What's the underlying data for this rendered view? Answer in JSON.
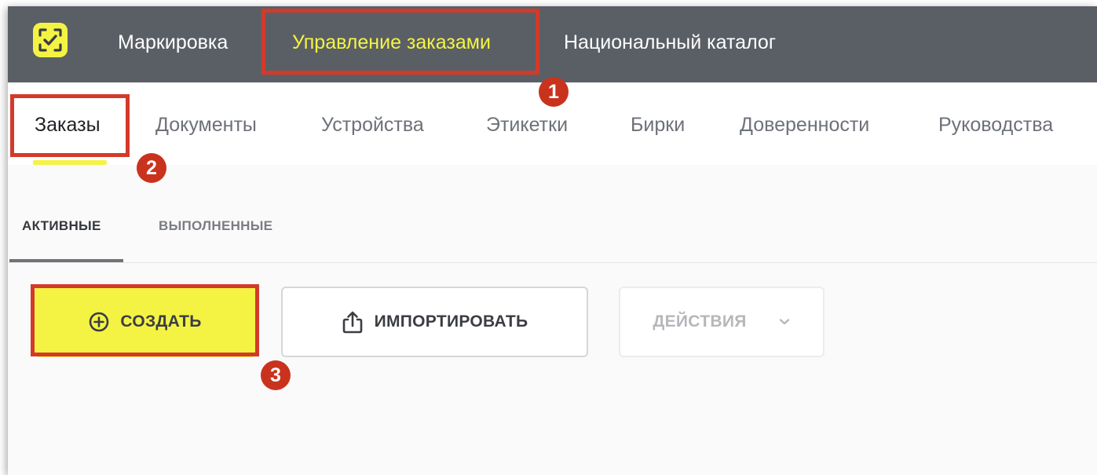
{
  "topbar": {
    "logo_icon": "checkmark-frame-icon",
    "items": [
      {
        "label": "Маркировка",
        "active": false
      },
      {
        "label": "Управление заказами",
        "active": true
      },
      {
        "label": "Национальный каталог",
        "active": false
      }
    ]
  },
  "subnav": {
    "items": [
      {
        "label": "Заказы",
        "active": true
      },
      {
        "label": "Документы",
        "active": false
      },
      {
        "label": "Устройства",
        "active": false
      },
      {
        "label": "Этикетки",
        "active": false
      },
      {
        "label": "Бирки",
        "active": false
      },
      {
        "label": "Доверенности",
        "active": false
      },
      {
        "label": "Руководства",
        "active": false
      }
    ]
  },
  "tabs": {
    "items": [
      {
        "label": "АКТИВНЫЕ",
        "active": true
      },
      {
        "label": "ВЫПОЛНЕННЫЕ",
        "active": false
      }
    ]
  },
  "actions": {
    "create_label": "СОЗДАТЬ",
    "create_icon": "plus-circle-icon",
    "import_label": "ИМПОРТИРОВАТЬ",
    "import_icon": "upload-icon",
    "actions_label": "ДЕЙСТВИЯ",
    "actions_icon": "chevron-down-icon",
    "actions_disabled": true
  },
  "annotations": {
    "badges": [
      "1",
      "2",
      "3"
    ],
    "highlight_color": "#d23a2a"
  },
  "colors": {
    "accent": "#f4f344",
    "topbar_bg": "#5a5f66",
    "badge": "#c9331d"
  }
}
